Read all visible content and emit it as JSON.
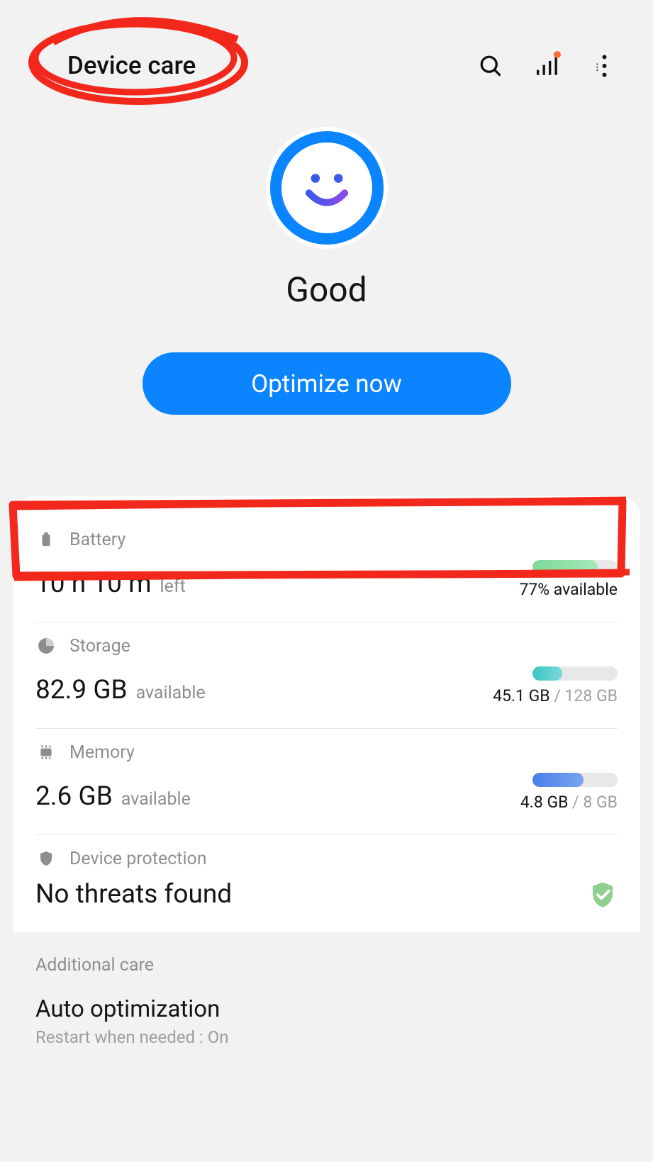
{
  "header": {
    "title": "Device care"
  },
  "hero": {
    "status": "Good",
    "button": "Optimize now"
  },
  "battery": {
    "label": "Battery",
    "value": "10 h 10 m",
    "suffix": "left",
    "avail": "77% available",
    "percent": 77
  },
  "storage": {
    "label": "Storage",
    "value": "82.9 GB",
    "suffix": "available",
    "used": "45.1 GB",
    "total": " / 128 GB"
  },
  "memory": {
    "label": "Memory",
    "value": "2.6 GB",
    "suffix": "available",
    "used": "4.8 GB",
    "total": " / 8 GB"
  },
  "protection": {
    "label": "Device protection",
    "status": "No threats found"
  },
  "additional": {
    "heading": "Additional care",
    "auto_title": "Auto optimization",
    "auto_sub": "Restart when needed : On"
  }
}
